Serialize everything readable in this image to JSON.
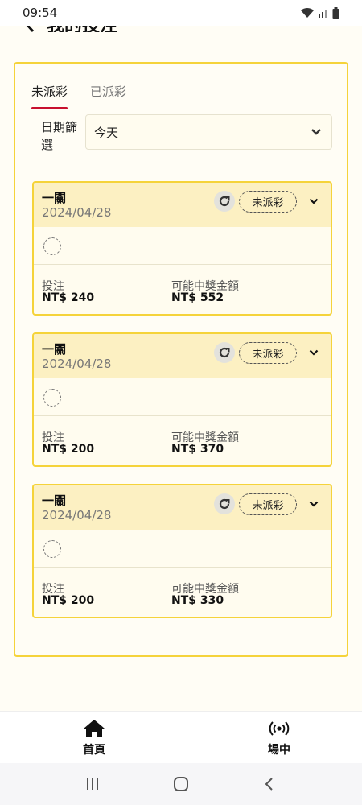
{
  "status_bar": {
    "time": "09:54"
  },
  "header": {
    "title": "我的投注"
  },
  "tabs": [
    {
      "label": "未派彩"
    },
    {
      "label": "已派彩"
    }
  ],
  "filter": {
    "label": "日期篩選",
    "value": "今天"
  },
  "cards": [
    {
      "title": "一關",
      "date": "2024/04/28",
      "status": "未派彩",
      "stake_label": "投注",
      "stake": "NT$ 240",
      "win_label": "可能中獎金額",
      "win": "NT$ 552"
    },
    {
      "title": "一關",
      "date": "2024/04/28",
      "status": "未派彩",
      "stake_label": "投注",
      "stake": "NT$ 200",
      "win_label": "可能中獎金額",
      "win": "NT$ 370"
    },
    {
      "title": "一關",
      "date": "2024/04/28",
      "status": "未派彩",
      "stake_label": "投注",
      "stake": "NT$ 200",
      "win_label": "可能中獎金額",
      "win": "NT$ 330"
    }
  ],
  "bottom_nav": [
    {
      "label": "首頁",
      "icon": "home-icon"
    },
    {
      "label": "場中",
      "icon": "live-broadcast-icon"
    }
  ],
  "colors": {
    "accent": "#f5d33a",
    "tab_underline": "#c8102e",
    "card_head": "#fcf0c2",
    "background": "#fffdf5"
  }
}
